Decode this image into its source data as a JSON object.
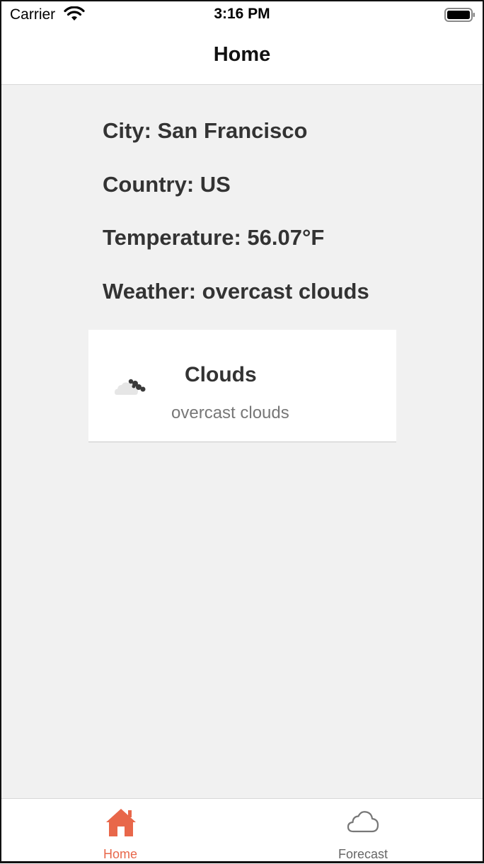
{
  "status_bar": {
    "carrier": "Carrier",
    "time": "3:16 PM",
    "icons": [
      "wifi-icon",
      "battery-icon"
    ]
  },
  "nav": {
    "title": "Home"
  },
  "info": {
    "city": "City: San Francisco",
    "country": "Country: US",
    "temperature": "Temperature: 56.07°F",
    "weather": "Weather: overcast clouds"
  },
  "card": {
    "icon": "cloud-icon",
    "main": "Clouds",
    "description": "overcast clouds"
  },
  "tabs": [
    {
      "label": "Home",
      "icon": "home-icon",
      "active": true
    },
    {
      "label": "Forecast",
      "icon": "cloud-icon",
      "active": false
    }
  ],
  "colors": {
    "accent": "#e8674a",
    "background": "#f1f1f1",
    "text": "#333333",
    "inactive_tab": "#666666"
  }
}
